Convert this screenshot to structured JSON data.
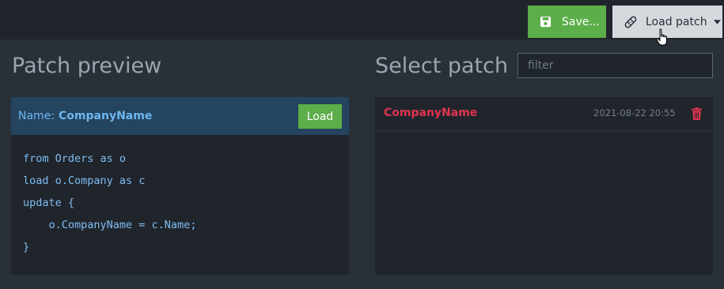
{
  "toolbar": {
    "save_label": "Save...",
    "load_patch_label": "Load patch"
  },
  "preview": {
    "heading": "Patch preview",
    "name_label": "Name:",
    "name_value": "CompanyName",
    "load_label": "Load",
    "code_lines": [
      "from Orders as o",
      "load o.Company as c",
      "update {",
      "    o.CompanyName = c.Name;",
      "}"
    ]
  },
  "select": {
    "heading": "Select patch",
    "filter_placeholder": "filter",
    "items": [
      {
        "name": "CompanyName",
        "date": "2021-08-22 20:55"
      }
    ]
  },
  "colors": {
    "background": "#2a3038",
    "topbar": "#20252c",
    "accent_green": "#5cae4a",
    "header_blue": "#25445f",
    "name_blue": "#6cb7f0",
    "danger_red": "#e0344f"
  },
  "icons": {
    "save": "floppy-disk-icon",
    "load_patch": "bandaid-icon",
    "dropdown": "caret-down-icon",
    "delete": "trash-icon",
    "cursor": "hand-pointer-icon"
  }
}
